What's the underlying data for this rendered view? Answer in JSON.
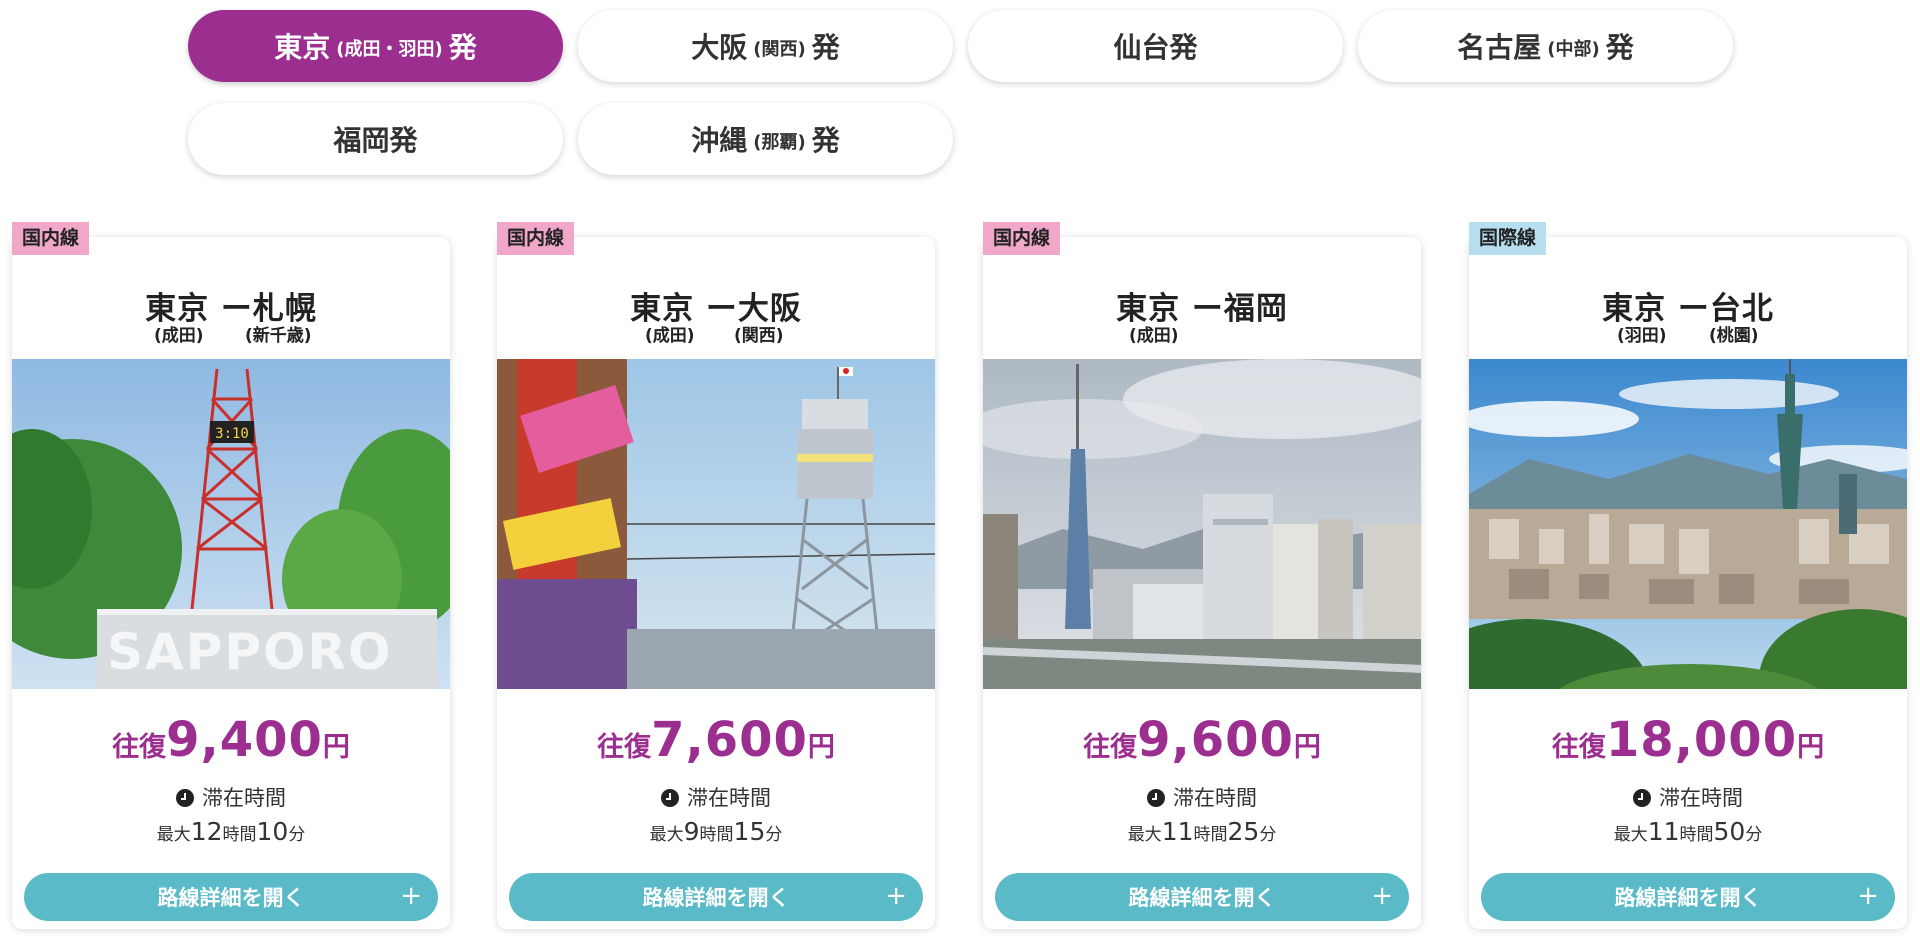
{
  "origin_tabs": [
    {
      "main": "東京",
      "sub": "(成田・羽田)",
      "suffix": "発"
    },
    {
      "main": "大阪",
      "sub": "(関西)",
      "suffix": "発"
    },
    {
      "main": "仙台発",
      "sub": "",
      "suffix": ""
    },
    {
      "main": "名古屋",
      "sub": "(中部)",
      "suffix": "発"
    },
    {
      "main": "福岡発",
      "sub": "",
      "suffix": ""
    },
    {
      "main": "沖縄",
      "sub": "(那覇)",
      "suffix": "発"
    }
  ],
  "active_tab": 0,
  "routes": [
    {
      "badge": "国内線",
      "badge_type": "domestic",
      "title": "東京 ー札幌",
      "from_airport": "(成田)",
      "to_airport": "(新千歳)",
      "price_prefix": "往復",
      "price": "9,400",
      "price_unit": "円",
      "stay_label": "滞在時間",
      "stay_prefix": "最大",
      "stay_hours": "12",
      "hours_unit": "時間",
      "stay_minutes": "10",
      "minutes_unit": "分",
      "button_label": "路線詳細を開く",
      "button_icon": "+"
    },
    {
      "badge": "国内線",
      "badge_type": "domestic",
      "title": "東京 ー大阪",
      "from_airport": "(成田)",
      "to_airport": "(関西)",
      "price_prefix": "往復",
      "price": "7,600",
      "price_unit": "円",
      "stay_label": "滞在時間",
      "stay_prefix": "最大",
      "stay_hours": "9",
      "hours_unit": "時間",
      "stay_minutes": "15",
      "minutes_unit": "分",
      "button_label": "路線詳細を開く",
      "button_icon": "+"
    },
    {
      "badge": "国内線",
      "badge_type": "domestic",
      "title": "東京 ー福岡",
      "from_airport": "(成田)",
      "to_airport": "",
      "price_prefix": "往復",
      "price": "9,600",
      "price_unit": "円",
      "stay_label": "滞在時間",
      "stay_prefix": "最大",
      "stay_hours": "11",
      "hours_unit": "時間",
      "stay_minutes": "25",
      "minutes_unit": "分",
      "button_label": "路線詳細を開く",
      "button_icon": "+"
    },
    {
      "badge": "国際線",
      "badge_type": "international",
      "title": "東京 ー台北",
      "from_airport": "(羽田)",
      "to_airport": "(桃園)",
      "price_prefix": "往復",
      "price": "18,000",
      "price_unit": "円",
      "stay_label": "滞在時間",
      "stay_prefix": "最大",
      "stay_hours": "11",
      "hours_unit": "時間",
      "stay_minutes": "50",
      "minutes_unit": "分",
      "button_label": "路線詳細を開く",
      "button_icon": "+"
    }
  ],
  "colors": {
    "accent_purple": "#9b2e8f",
    "button_teal": "#5bbac8",
    "domestic_badge": "#f0a7c8",
    "international_badge": "#b8dff0"
  }
}
